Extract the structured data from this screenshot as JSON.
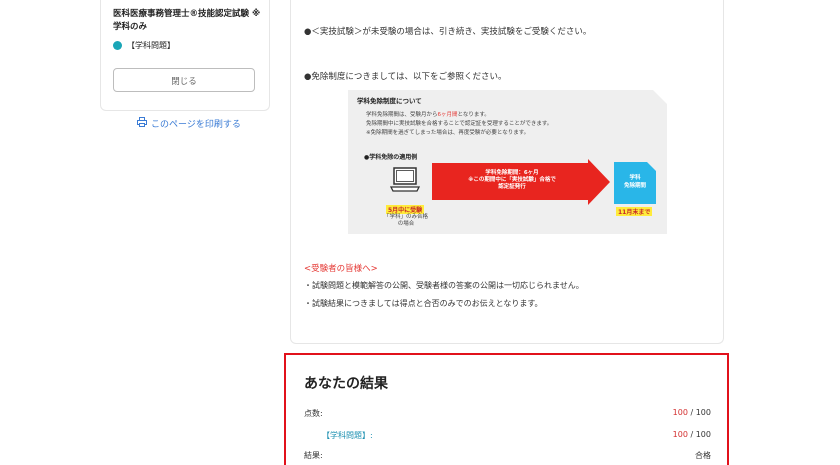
{
  "sidebar": {
    "exam_title": "医科医療事務管理士®技能認定試験 ※学科のみ",
    "category_label": "【学科問題】",
    "close_label": "閉じる",
    "print_label": "このページを印刷する",
    "accent": "#1aa6b7"
  },
  "main": {
    "p1": "●＜実技試験＞が未受験の場合は、引き続き、実技試験をご受験ください。",
    "p2": "●免除制度につきましては、以下をご参照ください。",
    "figure": {
      "heading": "学科免除制度について",
      "line1_pre": "学科免除期間は、受験月から",
      "line1_hl": "6ヶ月間",
      "line1_post": "となります。",
      "line2": "免除期間中に実技試験を合格することで認定証を受理することができます。",
      "line3": "※免除期間を過ぎてしまった場合は、再度受験が必要となります。",
      "subheading": "●学科免除の適用例",
      "may_label": "5月中に受験",
      "pass_note_1": "「学科」のみ合格",
      "pass_note_2": "の場合",
      "arrow_line1": "学科免除期間：6ヶ月",
      "arrow_line2": "※この期間中に「実技試験」合格で",
      "arrow_line3": "認定証発行",
      "doc_line1": "学科",
      "doc_line2": "免除期間",
      "nov_label": "11月末まで"
    },
    "notice_head": "<受験者の皆様へ>",
    "bullet1": "・試験問題と模範解答の公開、受験者様の答案の公開は一切応じられません。",
    "bullet2": "・試験結果につきましては得点と合否のみでのお伝えとなります。"
  },
  "result": {
    "title": "あなたの結果",
    "score_label": "点数:",
    "score_value": "100",
    "score_total": " / 100",
    "category_label": "【学科問題】:",
    "category_value": "100",
    "category_total": " / 100",
    "outcome_label": "結果:",
    "outcome_value": "合格",
    "border_color": "#e1111b"
  }
}
